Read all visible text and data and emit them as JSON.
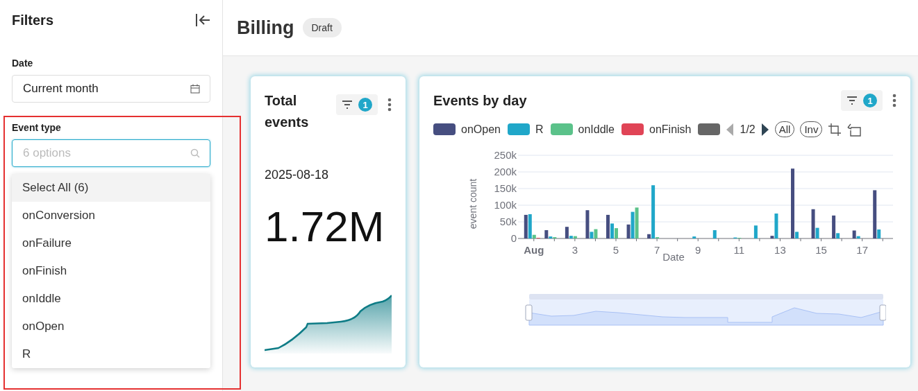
{
  "sidebar": {
    "title": "Filters",
    "date_filter": {
      "label": "Date",
      "value": "Current month"
    },
    "event_type_filter": {
      "label": "Event type",
      "placeholder": "6 options",
      "focused": true,
      "options": [
        {
          "label": "Select All (6)",
          "highlighted": true
        },
        {
          "label": "onConversion",
          "highlighted": false
        },
        {
          "label": "onFailure",
          "highlighted": false
        },
        {
          "label": "onFinish",
          "highlighted": false
        },
        {
          "label": "onIddle",
          "highlighted": false
        },
        {
          "label": "onOpen",
          "highlighted": false
        },
        {
          "label": "R",
          "highlighted": false
        }
      ]
    }
  },
  "header": {
    "title": "Billing",
    "badge": "Draft"
  },
  "total_card": {
    "title": "Total events",
    "filter_count": "1",
    "date": "2025-08-18",
    "value": "1.72M"
  },
  "events_card": {
    "title": "Events by day",
    "filter_count": "1",
    "zoom_slider": {
      "level": 1
    },
    "legend_page": "1/2",
    "legend_prev_disabled": true,
    "legend_next_disabled": false,
    "all_label": "All",
    "inverse_label": "Inv",
    "chart_data": {
      "type": "bar",
      "xlabel": "Date",
      "ylabel": "event count",
      "x": [
        1,
        2,
        3,
        4,
        5,
        6,
        7,
        8,
        9,
        10,
        11,
        12,
        13,
        14,
        15,
        16,
        17,
        18
      ],
      "xlim": [
        0.5,
        18.5
      ],
      "grid": true,
      "series": [
        {
          "name": "onOpen",
          "color": "#464e80",
          "values": [
            71000,
            25000,
            35000,
            85000,
            71000,
            42000,
            13000,
            0,
            0,
            null,
            0,
            0,
            8000,
            210000,
            88000,
            69000,
            24000,
            145000
          ]
        },
        {
          "name": "R",
          "color": "#20a7c9",
          "values": [
            73000,
            6000,
            8000,
            20000,
            45000,
            80000,
            160000,
            0,
            6000,
            25000,
            3000,
            39000,
            75000,
            20000,
            32000,
            16000,
            7000,
            27000
          ]
        },
        {
          "name": "onIddle",
          "color": "#5bc28a",
          "values": [
            11000,
            4000,
            7000,
            28000,
            31000,
            93000,
            4000,
            0,
            0,
            0,
            2000,
            null,
            0,
            0,
            0,
            0,
            0,
            0
          ]
        },
        {
          "name": "onFinish",
          "color": "#e04456",
          "values": [
            2000,
            0,
            0,
            0,
            0,
            0,
            0,
            0,
            0,
            0,
            0,
            0,
            0,
            0,
            null,
            0,
            0,
            0
          ]
        },
        {
          "color": "#666666",
          "values": [
            null,
            null,
            null,
            null,
            null,
            null,
            null,
            null,
            null,
            null,
            null,
            null,
            null,
            null,
            null,
            null,
            null,
            null
          ]
        }
      ],
      "ylim": [
        0,
        250000
      ],
      "yticks": [
        {
          "value": 0,
          "label": "0"
        },
        {
          "value": 50000,
          "label": "50k"
        },
        {
          "value": 100000,
          "label": "100k"
        },
        {
          "value": 150000,
          "label": "150k"
        },
        {
          "value": 200000,
          "label": "200k"
        },
        {
          "value": 250000,
          "label": "250k"
        }
      ],
      "xticks": [
        {
          "value": 1,
          "label": "Aug"
        },
        {
          "value": 3,
          "label": "3"
        },
        {
          "value": 5,
          "label": "5"
        },
        {
          "value": 7,
          "label": "7"
        },
        {
          "value": 9,
          "label": "9"
        },
        {
          "value": 11,
          "label": "11"
        },
        {
          "value": 13,
          "label": "13"
        },
        {
          "value": 15,
          "label": "15"
        },
        {
          "value": 17,
          "label": "17"
        }
      ]
    }
  }
}
